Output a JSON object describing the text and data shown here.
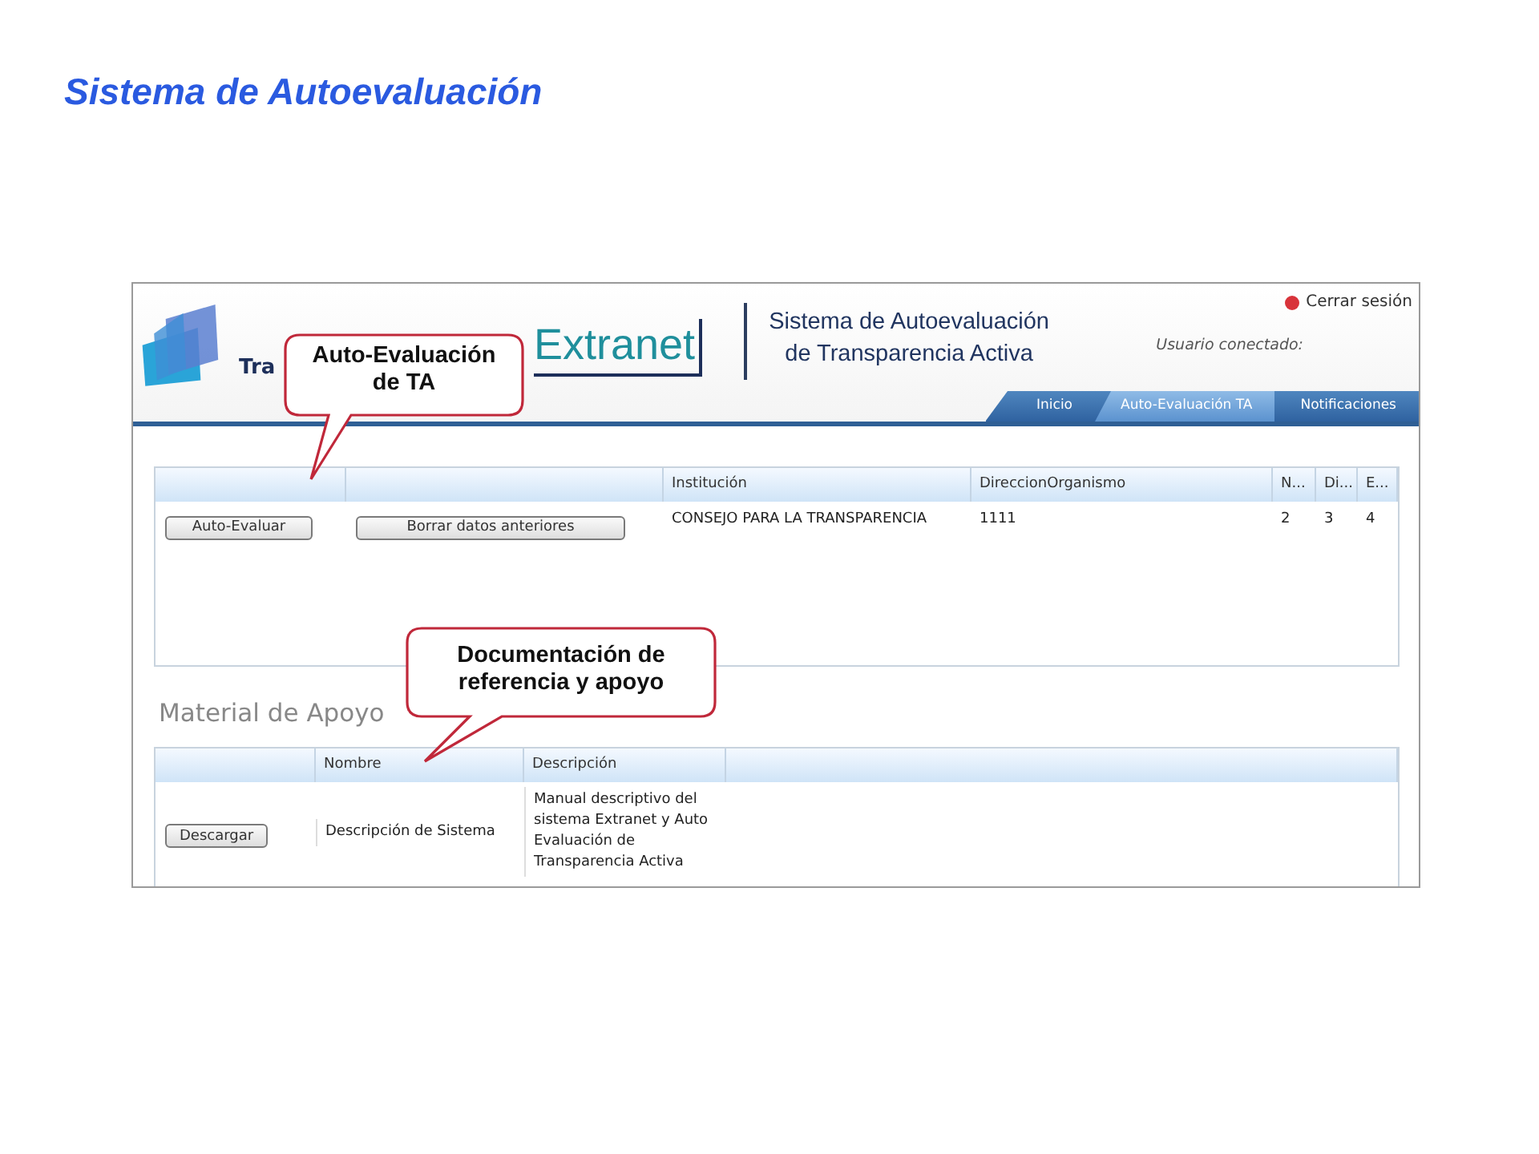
{
  "slide_title": "Sistema de Autoevaluación",
  "header": {
    "logo_text": "Tra",
    "product": "Extranet",
    "system_title": [
      "Sistema de Autoevaluación",
      "de Transparencia Activa"
    ],
    "logout": "Cerrar sesión",
    "user_label": "Usuario conectado:",
    "nav": [
      {
        "label": "Inicio",
        "selected": false
      },
      {
        "label": "Auto-Evaluación TA",
        "selected": true
      },
      {
        "label": "Notificaciones",
        "selected": false
      }
    ]
  },
  "evaluations": {
    "columns": [
      "Institución",
      "DireccionOrganismo",
      "N...",
      "Di...",
      "E..."
    ],
    "rows": [
      {
        "actions": [
          "Auto-Evaluar",
          "Borrar datos anteriores"
        ],
        "cells": [
          "CONSEJO PARA LA TRANSPARENCIA",
          "1111",
          "2",
          "3",
          "4"
        ]
      }
    ]
  },
  "materials": {
    "title": "Material de Apoyo",
    "columns": [
      "Nombre",
      "Descripción"
    ],
    "rows": [
      {
        "action": "Descargar",
        "name": "Descripción de Sistema",
        "description": "Manual descriptivo del sistema Extranet y Auto Evaluación de Transparencia Activa"
      }
    ]
  },
  "callouts": [
    {
      "text": "Auto-Evaluación de TA"
    },
    {
      "text": "Documentación de referencia y apoyo"
    }
  ]
}
